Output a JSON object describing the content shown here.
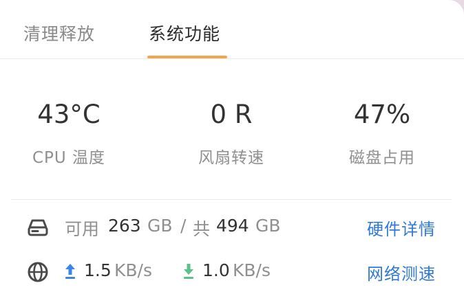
{
  "tabs": [
    {
      "label": "清理释放",
      "active": false
    },
    {
      "label": "系统功能",
      "active": true
    }
  ],
  "accent_color": "#f0a74a",
  "stats": [
    {
      "value": "43°C",
      "label": "CPU 温度"
    },
    {
      "value": "0 R",
      "label": "风扇转速"
    },
    {
      "value": "47%",
      "label": "磁盘占用"
    }
  ],
  "disk": {
    "icon": "hard-drive-icon",
    "available_label": "可用",
    "available_value": "263",
    "available_unit": "GB",
    "separator": "/",
    "total_label": "共",
    "total_value": "494",
    "total_unit": "GB",
    "link": "硬件详情"
  },
  "network": {
    "icon": "globe-icon",
    "upload_icon": "upload-arrow-icon",
    "upload_value": "1.5",
    "upload_unit": "KB/s",
    "download_icon": "download-arrow-icon",
    "download_value": "1.0",
    "download_unit": "KB/s",
    "link": "网络测速",
    "upload_color": "#3a86e6",
    "download_color": "#5cc08a"
  },
  "link_color": "#3179d6"
}
